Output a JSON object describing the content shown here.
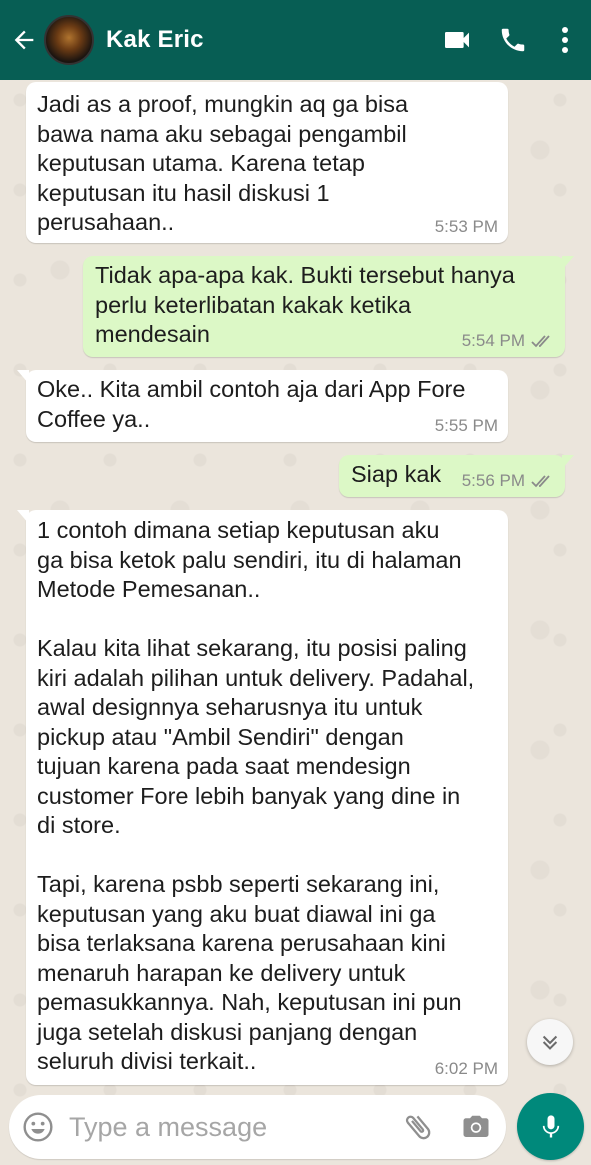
{
  "header": {
    "contact_name": "Kak Eric",
    "icons": [
      "back-arrow-icon",
      "video-call-icon",
      "phone-icon",
      "more-options-icon"
    ],
    "bg_color": "#075e54"
  },
  "messages": [
    {
      "direction": "in",
      "text": "Jadi as a proof, mungkin aq ga bisa\nbawa nama aku sebagai pengambil\nkeputusan utama. Karena tetap\nkeputusan itu hasil diskusi 1\nperusahaan..",
      "time": "5:53 PM"
    },
    {
      "direction": "out",
      "text": "Tidak apa-apa kak. Bukti tersebut hanya\nperlu keterlibatan kakak ketika\nmendesain",
      "time": "5:54 PM",
      "status": "read"
    },
    {
      "direction": "in",
      "text": "Oke.. Kita ambil contoh aja dari App Fore\nCoffee ya..",
      "time": "5:55 PM"
    },
    {
      "direction": "out",
      "text": "Siap kak",
      "time": "5:56 PM",
      "status": "read"
    },
    {
      "direction": "in",
      "text": "1 contoh dimana setiap keputusan aku\nga bisa ketok palu sendiri, itu di halaman\nMetode Pemesanan..\n\nKalau kita lihat sekarang, itu posisi paling\nkiri adalah pilihan untuk delivery. Padahal,\nawal designnya seharusnya itu untuk\npickup atau \"Ambil Sendiri\" dengan\ntujuan karena pada saat mendesign\ncustomer Fore lebih banyak yang dine in\ndi store.\n\nTapi, karena psbb seperti sekarang ini,\nkeputusan yang aku buat diawal ini ga\nbisa terlaksana karena perusahaan kini\nmenaruh harapan ke delivery untuk\npemasukkannya. Nah, keputusan ini pun\njuga setelah diskusi panjang dengan\nseluruh divisi terkait..",
      "time": "6:02 PM"
    }
  ],
  "input": {
    "placeholder": "Type a message",
    "icons": [
      "emoji-icon",
      "attach-icon",
      "camera-icon",
      "mic-icon"
    ]
  },
  "colors": {
    "incoming_bubble": "#ffffff",
    "outgoing_bubble": "#dcf8c6",
    "mic_button": "#00897b",
    "read_ticks": "#8a8a8a"
  }
}
